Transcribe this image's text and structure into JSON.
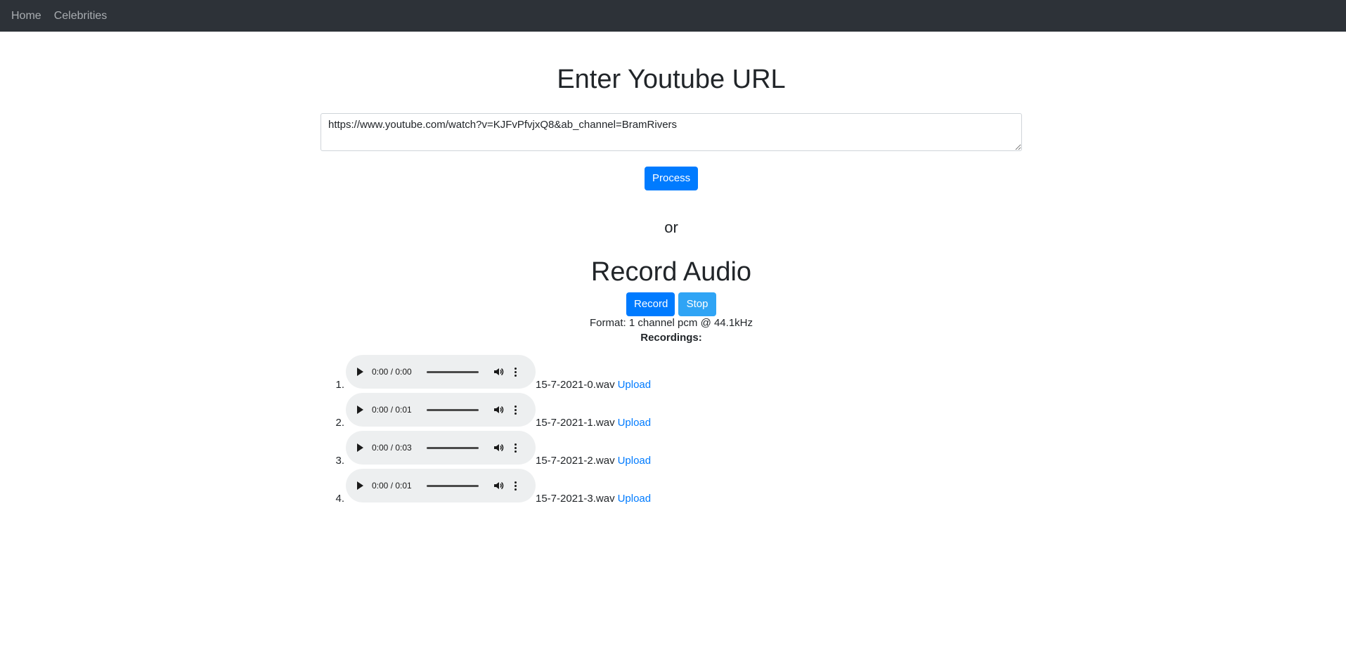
{
  "nav": {
    "items": [
      {
        "label": "Home"
      },
      {
        "label": "Celebrities"
      }
    ]
  },
  "youtube": {
    "title": "Enter Youtube URL",
    "url_value": "https://www.youtube.com/watch?v=KJFvPfvjxQ8&ab_channel=BramRivers",
    "process_label": "Process"
  },
  "or_text": "or",
  "recorder": {
    "title": "Record Audio",
    "record_label": "Record",
    "stop_label": "Stop",
    "format_text": "Format: 1 channel pcm @ 44.1kHz",
    "recordings_label": "Recordings:"
  },
  "recordings": [
    {
      "num": "1.",
      "time": "0:00 / 0:00",
      "file": "15-7-2021-0.wav",
      "upload": "Upload"
    },
    {
      "num": "2.",
      "time": "0:00 / 0:01",
      "file": "15-7-2021-1.wav",
      "upload": "Upload"
    },
    {
      "num": "3.",
      "time": "0:00 / 0:03",
      "file": "15-7-2021-2.wav",
      "upload": "Upload"
    },
    {
      "num": "4.",
      "time": "0:00 / 0:01",
      "file": "15-7-2021-3.wav",
      "upload": "Upload"
    }
  ],
  "colors": {
    "navbar_bg": "#2d3238",
    "primary": "#007bff",
    "stop_button": "#2fa4f5",
    "player_bg": "#edeff0"
  }
}
